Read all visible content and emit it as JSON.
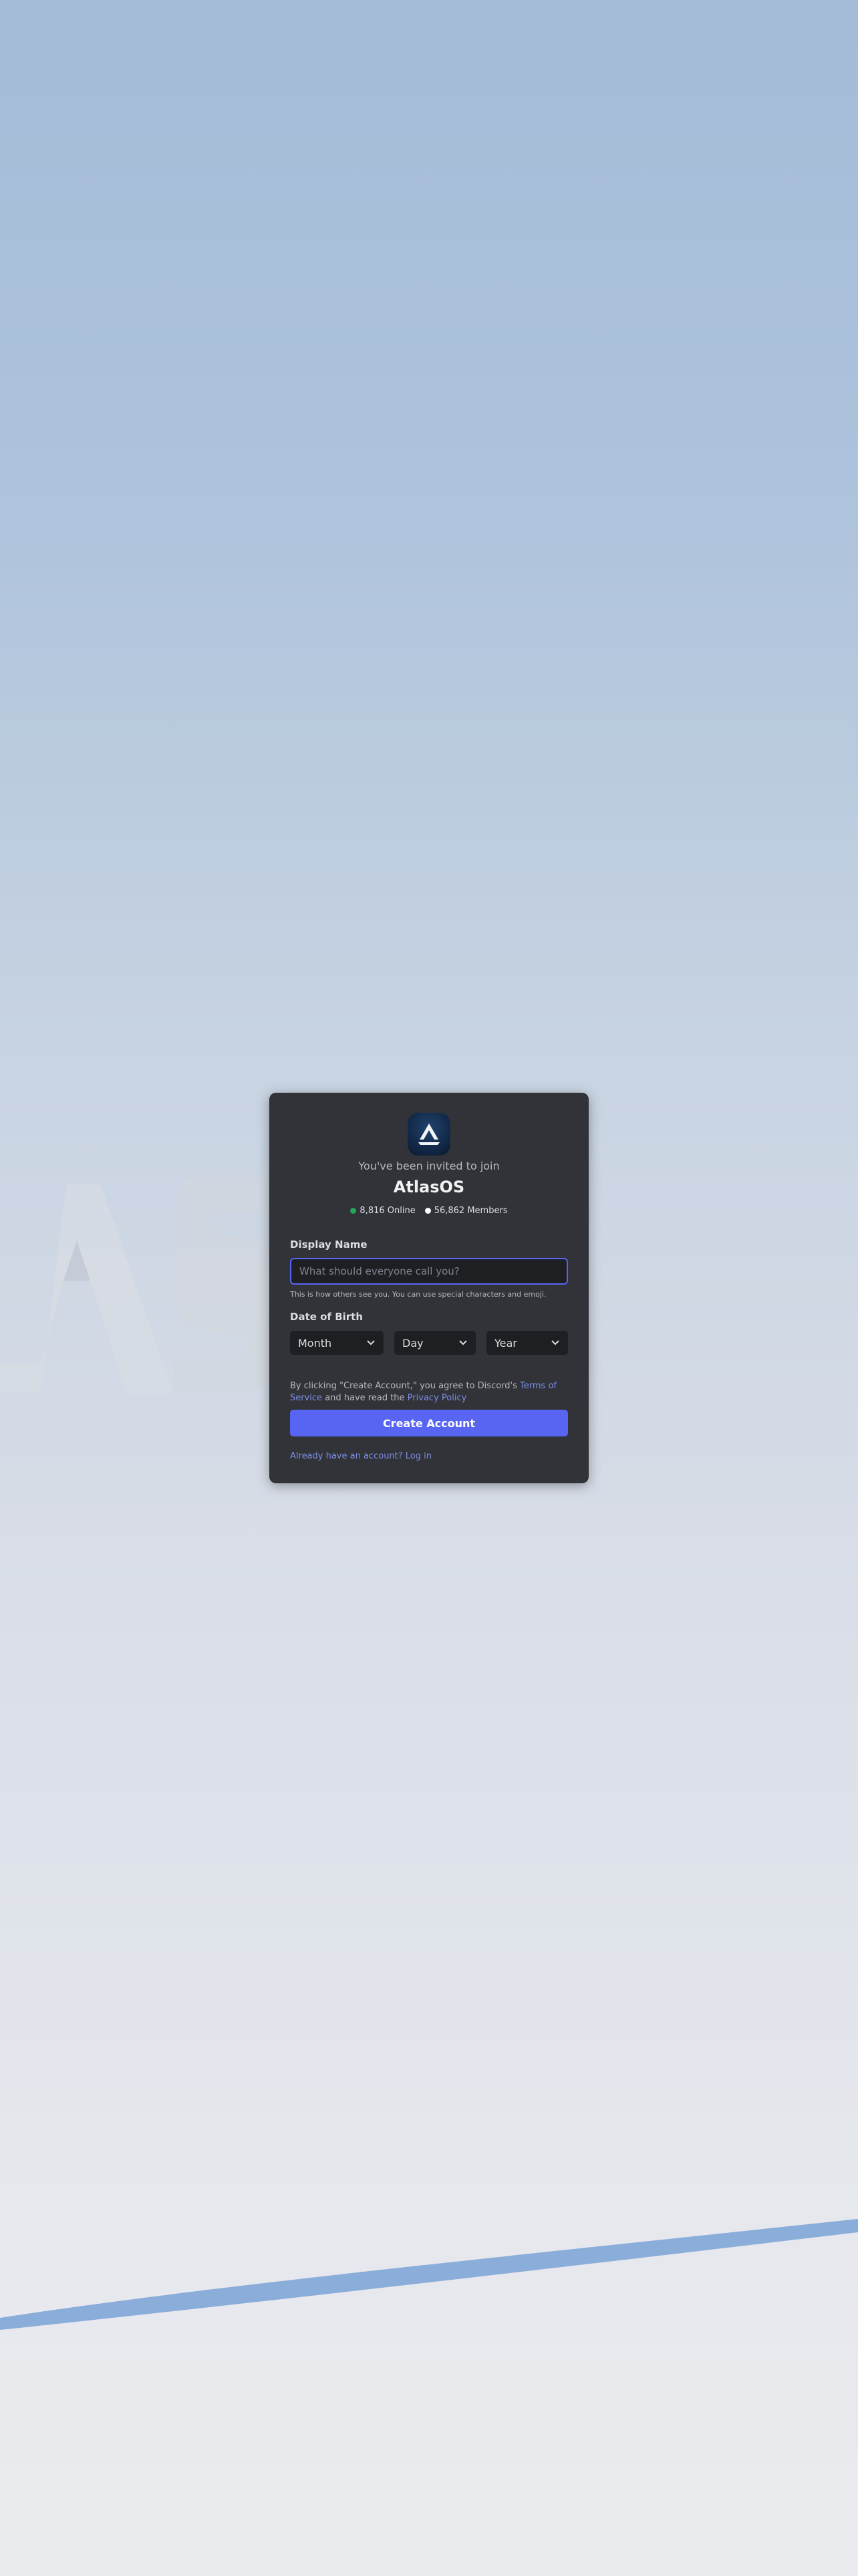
{
  "colors": {
    "accent": "#5865f2",
    "card_bg": "#313338",
    "input_bg": "#1e1f22",
    "online": "#23a55a",
    "link": "#7b8fe8"
  },
  "invite": {
    "intro": "You've been invited to join",
    "server_name": "AtlasOS",
    "server_icon": "atlasos-logo-icon",
    "online_count": "8,816 Online",
    "member_count": "56,862 Members"
  },
  "form": {
    "display_name_label": "Display Name",
    "display_name_placeholder": "What should everyone call you?",
    "display_name_hint": "This is how others see you. You can use special characters and emoji.",
    "dob_label": "Date of Birth",
    "month": "Month",
    "day": "Day",
    "year": "Year"
  },
  "legal": {
    "prefix": "By clicking \"Create Account,\" you agree to Discord's",
    "tos": "Terms of Service",
    "middle": "and have read the",
    "privacy": "Privacy Policy"
  },
  "create_button": "Create Account",
  "login_link": "Already have an account? Log in"
}
